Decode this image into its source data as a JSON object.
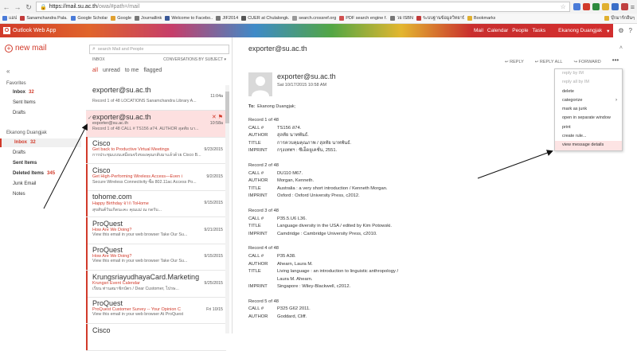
{
  "browser": {
    "url_host": "https://mail.su.ac.th",
    "url_path": "/owa/#path=/mail",
    "bookmarks": [
      {
        "label": "แอป",
        "color": "#4a7bd8"
      },
      {
        "label": "Sanamchandra Pala...",
        "color": "#c23b3b"
      },
      {
        "label": "Google Scholar",
        "color": "#4a7bd8"
      },
      {
        "label": "Google",
        "color": "#e0a030"
      },
      {
        "label": "Journallink",
        "color": "#777777"
      },
      {
        "label": "Welcome to Facebo...",
        "color": "#3b5998"
      },
      {
        "label": "JIF2014",
        "color": "#777777"
      },
      {
        "label": "CUER at Chulalongk...",
        "color": "#555555"
      },
      {
        "label": "search.crossref.org",
        "color": "#999999"
      },
      {
        "label": "PDF search engine f...",
        "color": "#d05050"
      },
      {
        "label": "วย ISBN",
        "color": "#777777"
      },
      {
        "label": "ระบบฐานข้อมูลวิทยานิพนธ์",
        "color": "#c23b3b"
      },
      {
        "label": "Bookmarks",
        "color": "#e0b030"
      }
    ],
    "other_bookmarks": "บุ๊กมาร์กอื่นๆ"
  },
  "owa": {
    "app_name": "Outlook Web App",
    "tabs": [
      "Mail",
      "Calendar",
      "People",
      "Tasks"
    ],
    "user": "Ekanong Duangjak",
    "new_mail": "new mail",
    "favorites_title": "Favorites",
    "favorites": [
      {
        "label": "Inbox",
        "count": "32",
        "bold": true
      },
      {
        "label": "Sent Items",
        "count": "",
        "bold": false
      },
      {
        "label": "Drafts",
        "count": "",
        "bold": false
      }
    ],
    "account_title": "Ekanong Duangjak",
    "account_folders": [
      {
        "label": "Inbox",
        "count": "32",
        "bold": true,
        "active": true
      },
      {
        "label": "Drafts",
        "count": "",
        "bold": false,
        "active": false
      },
      {
        "label": "Sent Items",
        "count": "",
        "bold": true,
        "active": false
      },
      {
        "label": "Deleted Items",
        "count": "345",
        "bold": true,
        "active": false
      },
      {
        "label": "Junk Email",
        "count": "",
        "bold": false,
        "active": false
      },
      {
        "label": "Notes",
        "count": "",
        "bold": false,
        "active": false
      }
    ]
  },
  "list": {
    "search_placeholder": "search Mail and People",
    "folder_label": "INBOX",
    "sort_label": "CONVERSATIONS BY SUBJECT",
    "filters": [
      "all",
      "unread",
      "to me",
      "flagged"
    ],
    "messages": [
      {
        "from": "exporter@su.ac.th",
        "subject": "",
        "preview": "Record 1 of 48 LOCATIONS Sanamchandra Library A...",
        "time": "11:04a",
        "unread": false,
        "selected": false
      },
      {
        "from": "exporter@su.ac.th",
        "subject": "exporter@su.ac.th",
        "preview": "Record 1 of 48 CALL # TS156 ส74. AUTHOR สุลทัย นา...",
        "time": "10:58a",
        "unread": false,
        "selected": true
      },
      {
        "from": "Cisco",
        "subject": "Get back to Productive Virtual Meetings",
        "preview": "การประชุมแบบเสมือนจริงของคุณกลับมาแล้วด้วย Cisco B...",
        "time": "9/23/2015",
        "unread": true,
        "selected": false
      },
      {
        "from": "Cisco",
        "subject": "Get High-Performing Wireless Access—Even i",
        "preview": "Secure Wireless Connectivity ซื้อ 802.11ac Access Po...",
        "time": "9/2/2015",
        "unread": true,
        "selected": false
      },
      {
        "from": "tohome.com",
        "subject": "Happy Birthday จาก ToHome",
        "preview": "สุขสันต์วันเกิดนะคะ คุณแม่ ณ กดรับ...",
        "time": "9/15/2015",
        "unread": true,
        "selected": false
      },
      {
        "from": "ProQuest",
        "subject": "How Are We Doing?",
        "preview": "View this email in your web browser     Take Our Su...",
        "time": "9/21/2015",
        "unread": true,
        "selected": false
      },
      {
        "from": "ProQuest",
        "subject": "How Are We Doing?",
        "preview": "View this email in your web browser     Take Our Su...",
        "time": "9/15/2015",
        "unread": true,
        "selected": false
      },
      {
        "from": "KrungsriayudhayaCard.Marketing",
        "subject": "Krungsri Event Calendar",
        "preview": "เรียน ท่านสมาชิกบัตร / Dear Customer,          ไปรษ...",
        "time": "9/25/2015",
        "unread": true,
        "selected": false
      },
      {
        "from": "ProQuest",
        "subject": "ProQuest Customer Survey -- Your Opinion C",
        "preview": "View this email in your web browser     At ProQuest",
        "time": "Fri 10/15",
        "unread": true,
        "selected": false
      },
      {
        "from": "Cisco",
        "subject": "",
        "preview": "",
        "time": "",
        "unread": true,
        "selected": false
      }
    ]
  },
  "reading": {
    "subject": "exporter@su.ac.th",
    "actions": [
      "REPLY",
      "REPLY ALL",
      "FORWARD"
    ],
    "more_label": "•••",
    "from": "exporter@su.ac.th",
    "date": "Sat 10/17/2015 10:58 AM",
    "to_label": "To:",
    "to_value": "Ekanong Duangjak;",
    "records": [
      {
        "title": "Record 1 of 48",
        "lines": [
          [
            "CALL #",
            "TS156 ส74."
          ],
          [
            "AUTHOR",
            "สุลทัย นาทพันธ์."
          ],
          [
            "TITLE",
            "การควบคุมคุณภาพ / สุลทัย นาทพันธ์."
          ],
          [
            "IMPRINT",
            "กรุงเทพฯ : ซีเอ็ดยูเคชั่น, 2551."
          ]
        ]
      },
      {
        "title": "Record 2 of 48",
        "lines": [
          [
            "CALL #",
            "DU110 M67."
          ],
          [
            "AUTHOR",
            "Morgan, Kenneth."
          ],
          [
            "TITLE",
            "Australia : a very short introduction / Kenneth Morgan."
          ],
          [
            "IMPRINT",
            "Oxford : Oxford University Press, c2012."
          ]
        ]
      },
      {
        "title": "Record 3 of 48",
        "lines": [
          [
            "CALL #",
            "P35.5.U6 L36."
          ],
          [
            "TITLE",
            "Language diversity in the USA / edited by Kim Potowski."
          ],
          [
            "IMPRINT",
            "Camdridge : Cambridge University Press, c2010."
          ]
        ]
      },
      {
        "title": "Record 4 of 48",
        "lines": [
          [
            "CALL #",
            "P35 A38."
          ],
          [
            "AUTHOR",
            "Ahearn, Laura M."
          ],
          [
            "TITLE",
            "Living language : an introduction to linguistic anthropology /"
          ],
          [
            "",
            "Laura M. Ahearn."
          ],
          [
            "IMPRINT",
            "Singapore : Wiley-Blackwell, c2012."
          ]
        ]
      },
      {
        "title": "Record 5 of 48",
        "lines": [
          [
            "CALL #",
            "P325 G62 2011."
          ],
          [
            "AUTHOR",
            "Goddard, Cliff."
          ]
        ]
      }
    ],
    "menu": [
      {
        "label": "reply by IM",
        "disabled": true,
        "submenu": false,
        "highlight": false
      },
      {
        "label": "reply all by IM",
        "disabled": true,
        "submenu": false,
        "highlight": false
      },
      {
        "label": "delete",
        "disabled": false,
        "submenu": false,
        "highlight": false
      },
      {
        "label": "categorize",
        "disabled": false,
        "submenu": true,
        "highlight": false
      },
      {
        "label": "mark as junk",
        "disabled": false,
        "submenu": false,
        "highlight": false
      },
      {
        "label": "open in separate window",
        "disabled": false,
        "submenu": false,
        "highlight": false
      },
      {
        "label": "print",
        "disabled": false,
        "submenu": false,
        "highlight": false
      },
      {
        "label": "create rule...",
        "disabled": false,
        "submenu": false,
        "highlight": false
      },
      {
        "label": "view message details",
        "disabled": false,
        "submenu": false,
        "highlight": true
      }
    ]
  },
  "colors": {
    "accent": "#d13a2a",
    "selected_bg": "#fde0e0"
  }
}
